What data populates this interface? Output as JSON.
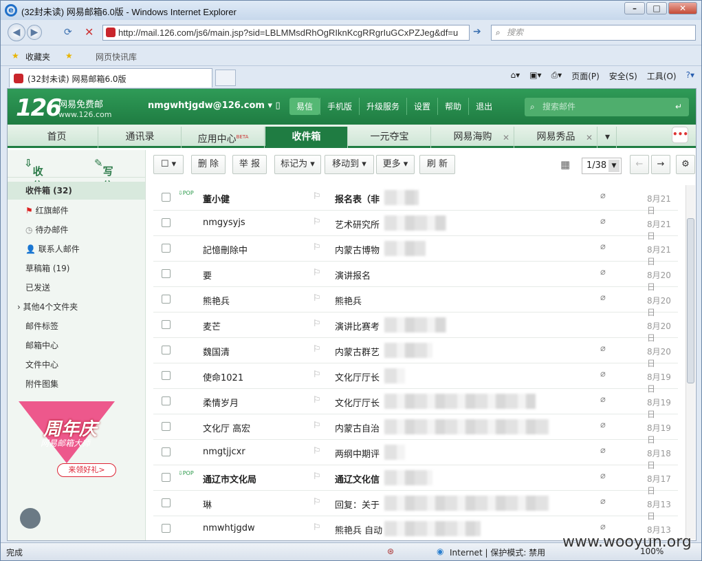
{
  "window": {
    "title": "(32封未读) 网易邮箱6.0版 - Windows Internet Explorer",
    "url": "http://mail.126.com/js6/main.jsp?sid=LBLMMsdRhOgRIknKcgRRgrIuGCxPZJeg&df=u",
    "search_placeholder": "搜索"
  },
  "favbar": {
    "favorites": "收藏夹",
    "quicklink": "网页快讯库"
  },
  "ietab": {
    "label": "(32封未读) 网易邮箱6.0版"
  },
  "cmdbar": {
    "page": "页面(P)",
    "safety": "安全(S)",
    "tools": "工具(O)"
  },
  "mail": {
    "logo": "126",
    "logo_line1": "网易免费邮",
    "logo_line2": "www.126.com",
    "account": "nmgwhtjgdw@126.com",
    "nav": [
      "易信",
      "手机版",
      "升级服务",
      "设置",
      "帮助",
      "退出"
    ],
    "search_placeholder": "搜索邮件",
    "tabs": [
      "首页",
      "通讯录",
      "应用中心",
      "收件箱",
      "一元夺宝",
      "网易海购",
      "网易秀品"
    ],
    "beta": "BETA",
    "receive": "收信",
    "compose": "写信",
    "folders": [
      "收件箱 (32)",
      "红旗邮件",
      "待办邮件",
      "联系人邮件",
      "草稿箱 (19)",
      "已发送",
      "其他4个文件夹",
      "邮件标签",
      "邮箱中心",
      "文件中心",
      "附件图集"
    ],
    "promo": {
      "title": "周年庆",
      "sub": "网易邮箱大师",
      "button": "来领好礼>"
    },
    "toolbar": {
      "delete": "删 除",
      "report": "举 报",
      "markas": "标记为",
      "moveto": "移动到",
      "more": "更多",
      "refresh": "刷 新",
      "page": "1/38"
    },
    "emails": [
      {
        "from": "董小健",
        "subject": "报名表（非",
        "date": "8月21日",
        "unread": true,
        "pop": true,
        "attach": true
      },
      {
        "from": "nmgysyjs",
        "subject": "艺术研究所",
        "date": "8月21日",
        "unread": false,
        "pop": false,
        "attach": true
      },
      {
        "from": "記憶刪除中",
        "subject": "内蒙古博物",
        "date": "8月21日",
        "unread": false,
        "pop": false,
        "attach": true
      },
      {
        "from": "要",
        "subject": "演讲报名",
        "date": "8月20日",
        "unread": false,
        "pop": false,
        "attach": true
      },
      {
        "from": "熊艳兵",
        "subject": "熊艳兵",
        "date": "8月20日",
        "unread": false,
        "pop": false,
        "attach": true
      },
      {
        "from": "麦芒",
        "subject": "演讲比赛考",
        "date": "8月20日",
        "unread": false,
        "pop": false,
        "attach": false
      },
      {
        "from": "魏国清",
        "subject": "内蒙古群艺",
        "date": "8月20日",
        "unread": false,
        "pop": false,
        "attach": true
      },
      {
        "from": "使命1021",
        "subject": "文化厅厅长",
        "date": "8月19日",
        "unread": false,
        "pop": false,
        "attach": true
      },
      {
        "from": "柔情岁月",
        "subject": "文化厅厅长",
        "date": "8月19日",
        "unread": false,
        "pop": false,
        "attach": true
      },
      {
        "from": "文化厅 高宏",
        "subject": "内蒙古自治",
        "date": "8月19日",
        "unread": false,
        "pop": false,
        "attach": true
      },
      {
        "from": "nmgtjjcxr",
        "subject": "两纲中期评",
        "date": "8月18日",
        "unread": false,
        "pop": false,
        "attach": true
      },
      {
        "from": "通辽市文化局",
        "subject": "通辽文化信",
        "date": "8月17日",
        "unread": true,
        "pop": true,
        "attach": true
      },
      {
        "from": "琳",
        "subject": "回复：关于",
        "date": "8月13日",
        "unread": false,
        "pop": false,
        "attach": true
      },
      {
        "from": "nmwhtjgdw",
        "subject": "熊艳兵 自动",
        "date": "8月13日",
        "unread": false,
        "pop": false,
        "attach": true
      }
    ]
  },
  "status": {
    "done": "完成",
    "zone": "Internet | 保护模式: 禁用",
    "zoom": "100%"
  },
  "watermark": "www.wooyun.org"
}
